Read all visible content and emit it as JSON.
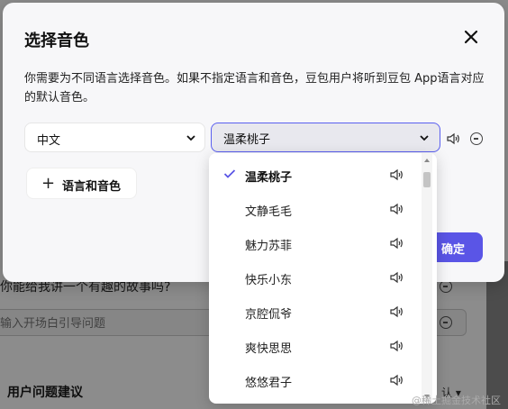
{
  "background": {
    "question_text": "你能给我讲一个有趣的故事吗?",
    "opening_input_placeholder": "输入开场白引导问题",
    "section_title": "用户问题建议",
    "right_label": "认",
    "watermark": "@稀土掘金技术社区"
  },
  "modal": {
    "title": "选择音色",
    "description": "你需要为不同语言选择音色。如果不指定语言和音色，豆包用户将听到豆包 App语言对应的默认音色。",
    "language_value": "中文",
    "voice_value": "温柔桃子",
    "add_button_label": "语言和音色",
    "confirm_label": "确定",
    "accent_color": "#5a55e6"
  },
  "dropdown": {
    "options": [
      {
        "name": "温柔桃子",
        "selected": true
      },
      {
        "name": "文静毛毛",
        "selected": false
      },
      {
        "name": "魅力苏菲",
        "selected": false
      },
      {
        "name": "快乐小东",
        "selected": false
      },
      {
        "name": "京腔侃爷",
        "selected": false
      },
      {
        "name": "爽快思思",
        "selected": false
      },
      {
        "name": "悠悠君子",
        "selected": false
      }
    ]
  }
}
